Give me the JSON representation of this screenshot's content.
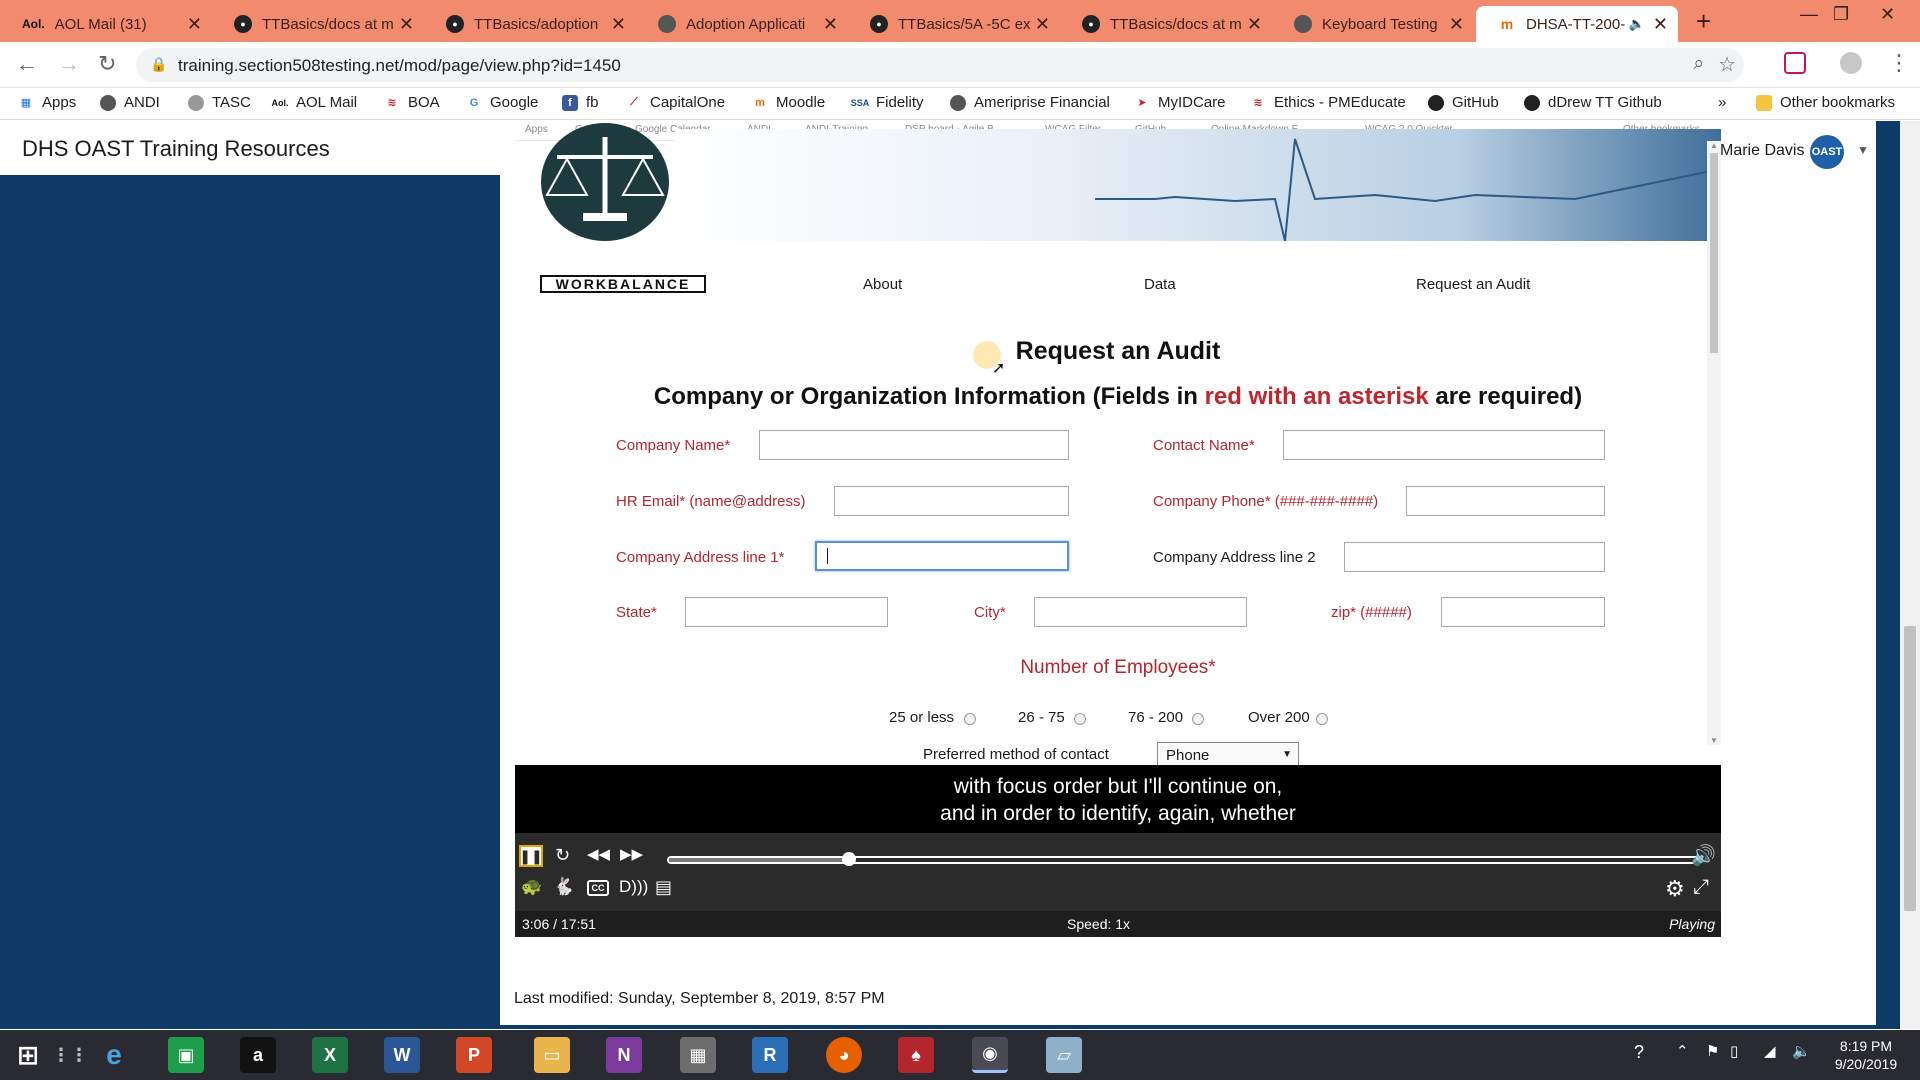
{
  "browser": {
    "tabs": [
      {
        "label": "AOL Mail (31)",
        "icon": "aol-icon"
      },
      {
        "label": "TTBasics/docs at m",
        "icon": "github-icon"
      },
      {
        "label": "TTBasics/adoption",
        "icon": "github-icon"
      },
      {
        "label": "Adoption Applicati",
        "icon": "globe-icon"
      },
      {
        "label": "TTBasics/5A -5C ex",
        "icon": "github-icon"
      },
      {
        "label": "TTBasics/docs at m",
        "icon": "github-icon"
      },
      {
        "label": "Keyboard Testing",
        "icon": "globe-icon"
      },
      {
        "label": "DHSA-TT-200-",
        "icon": "moodle-icon",
        "active": true
      }
    ],
    "url": "training.section508testing.net/mod/page/view.php?id=1450",
    "bookmarks": [
      "Apps",
      "ANDI",
      "TASC",
      "AOL Mail",
      "BOA",
      "Google",
      "fb",
      "CapitalOne",
      "Moodle",
      "Fidelity",
      "Ameriprise Financial",
      "MyIDCare",
      "Ethics - PMEducate",
      "GitHub",
      "dDrew TT Github"
    ],
    "other_bookmarks": "Other bookmarks",
    "more": "»",
    "tab_strip_color": "#f28b6e"
  },
  "site": {
    "title": "DHS OAST Training Resources",
    "user": "Marie Davis",
    "badge": "OAST"
  },
  "video": {
    "recorded_bookmarks": [
      "Apps",
      "Gmail",
      "Google Calendar",
      "ANDI",
      "ANDI-Training",
      "DSP board - Agile B...",
      "WCAG Filter",
      "GitHub",
      "Online Markdown E...",
      "WCAG 2.0 Quickter",
      "Other bookmarks"
    ],
    "logo_text": "WORKBALANCE",
    "nav": [
      "About",
      "Data",
      "Request an Audit"
    ],
    "heading": "Request an Audit",
    "subheading_prefix": "Company or Organization Information (Fields in ",
    "subheading_red": "red with an asterisk",
    "subheading_suffix": " are required)",
    "fields": {
      "company_name": "Company Name*",
      "contact_name": "Contact Name*",
      "hr_email": "HR Email* (name@address)",
      "company_phone": "Company Phone* (###-###-####)",
      "address1": "Company Address line 1*",
      "address2": "Company Address line 2",
      "state": "State*",
      "city": "City*",
      "zip": "zip* (#####)"
    },
    "employees_heading": "Number of Employees*",
    "employee_options": [
      "25 or less",
      "26 - 75",
      "76 - 200",
      "Over 200"
    ],
    "contact_label": "Preferred method of contact",
    "contact_value": "Phone",
    "caption_line1": "with focus order but I'll continue on,",
    "caption_line2": "and in order to identify, again, whether",
    "time": "3:06 / 17:51",
    "speed": "Speed: 1x",
    "state": "Playing",
    "progress": 0.175,
    "red_color": "#b3262e"
  },
  "footer": {
    "modified": "Last modified: Sunday, September 8, 2019, 8:57 PM"
  },
  "taskbar": {
    "time": "8:19 PM",
    "date": "9/20/2019",
    "apps": [
      "start-icon",
      "task-view-icon",
      "internet-explorer-icon",
      "store-icon",
      "amazon-icon",
      "excel-icon",
      "word-icon",
      "powerpoint-icon",
      "file-explorer-icon",
      "onenote-icon",
      "calculator-icon",
      "r-icon",
      "firefox-icon",
      "solitaire-icon",
      "chrome-icon",
      "notes-icon"
    ]
  }
}
